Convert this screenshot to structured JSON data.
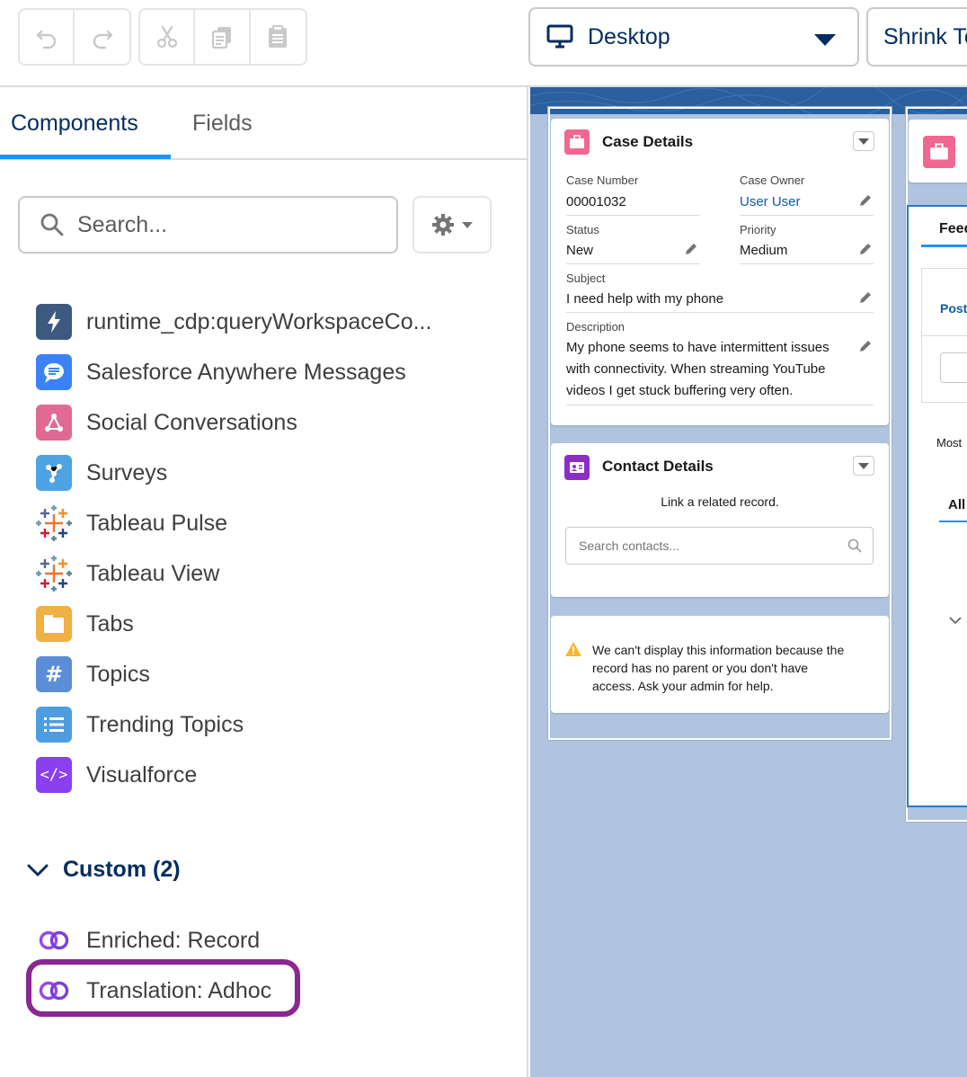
{
  "toolbar": {
    "undo_icon": "undo-icon",
    "redo_icon": "redo-icon",
    "cut_icon": "cut-icon",
    "copy_icon": "copy-icon",
    "paste_icon": "paste-icon",
    "device_label": "Desktop",
    "device_icon": "monitor-icon",
    "shrink_label": "Shrink To View"
  },
  "left_panel": {
    "tabs": [
      {
        "label": "Components",
        "active": true
      },
      {
        "label": "Fields",
        "active": false
      }
    ],
    "search": {
      "placeholder": "Search..."
    },
    "components": [
      {
        "label": "runtime_cdp:queryWorkspaceCo...",
        "icon": "lightning-icon",
        "color": "#3c5a80"
      },
      {
        "label": "Salesforce Anywhere Messages",
        "icon": "chat-icon",
        "color": "#3b82f6"
      },
      {
        "label": "Social Conversations",
        "icon": "social-icon",
        "color": "#e06a93"
      },
      {
        "label": "Surveys",
        "icon": "survey-icon",
        "color": "#4da3e3"
      },
      {
        "label": "Tableau Pulse",
        "icon": "tableau-icon",
        "color": ""
      },
      {
        "label": "Tableau View",
        "icon": "tableau-icon",
        "color": ""
      },
      {
        "label": "Tabs",
        "icon": "tabs-icon",
        "color": "#f0b043"
      },
      {
        "label": "Topics",
        "icon": "hash-icon",
        "color": "#5b8ed6"
      },
      {
        "label": "Trending Topics",
        "icon": "list-icon",
        "color": "#4d9de0"
      },
      {
        "label": "Visualforce",
        "icon": "code-icon",
        "color": "#8a3ff0"
      }
    ],
    "custom_section": {
      "label": "Custom (2)",
      "expanded": true
    },
    "custom_items": [
      {
        "label": "Enriched: Record",
        "icon": "link-icon"
      },
      {
        "label": "Translation: Adhoc",
        "icon": "link-icon",
        "highlighted": true
      }
    ]
  },
  "canvas": {
    "case_details": {
      "title": "Case Details",
      "fields": {
        "case_number_label": "Case Number",
        "case_number_value": "00001032",
        "case_owner_label": "Case Owner",
        "case_owner_value": "User User",
        "status_label": "Status",
        "status_value": "New",
        "priority_label": "Priority",
        "priority_value": "Medium",
        "subject_label": "Subject",
        "subject_value": "I need help with my phone",
        "description_label": "Description",
        "description_line1": "My phone seems to have intermittent issues",
        "description_line2": "with connectivity. When streaming YouTube",
        "description_line3": "videos I get stuck buffering very often."
      }
    },
    "contact_details": {
      "title": "Contact Details",
      "link_text": "Link a related record.",
      "search_placeholder": "Search contacts..."
    },
    "warning": {
      "line1": "We can't display this information because the",
      "line2": "record has no parent or you don't have",
      "line3": "access. Ask your admin for help."
    },
    "feed": {
      "tab_label": "Feed",
      "post_label": "Post",
      "sort_label": "Most",
      "filter_label": "All"
    }
  }
}
